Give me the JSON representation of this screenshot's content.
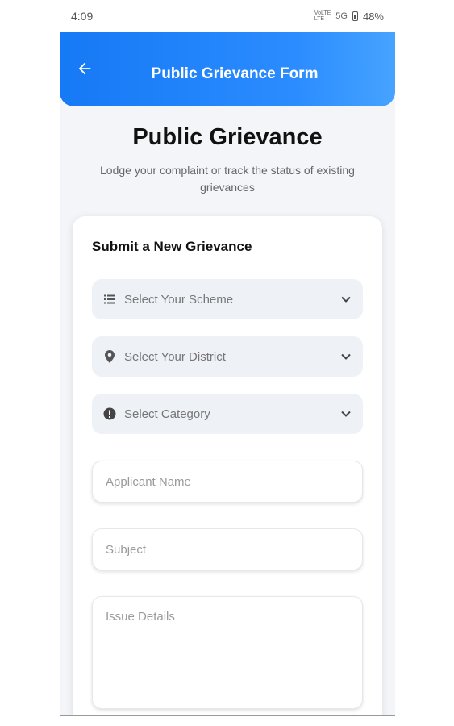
{
  "status_bar": {
    "time": "4:09",
    "network_top": "VoLTE",
    "network_bottom": "LTE",
    "signal": "5G",
    "battery": "48%"
  },
  "app_bar": {
    "title": "Public Grievance Form",
    "back_icon": "arrow-left-icon"
  },
  "header": {
    "title": "Public Grievance",
    "subtitle": "Lodge your complaint or track the status of existing grievances"
  },
  "form": {
    "title": "Submit a New Grievance",
    "selects": [
      {
        "placeholder": "Select Your Scheme",
        "icon": "list-icon"
      },
      {
        "placeholder": "Select Your District",
        "icon": "location-pin-icon"
      },
      {
        "placeholder": "Select Category",
        "icon": "alert-circle-icon"
      }
    ],
    "applicant_name_placeholder": "Applicant Name",
    "subject_placeholder": "Subject",
    "issue_details_placeholder": "Issue Details"
  },
  "colors": {
    "accent": "#1679f5",
    "background": "#f3f5f9"
  }
}
